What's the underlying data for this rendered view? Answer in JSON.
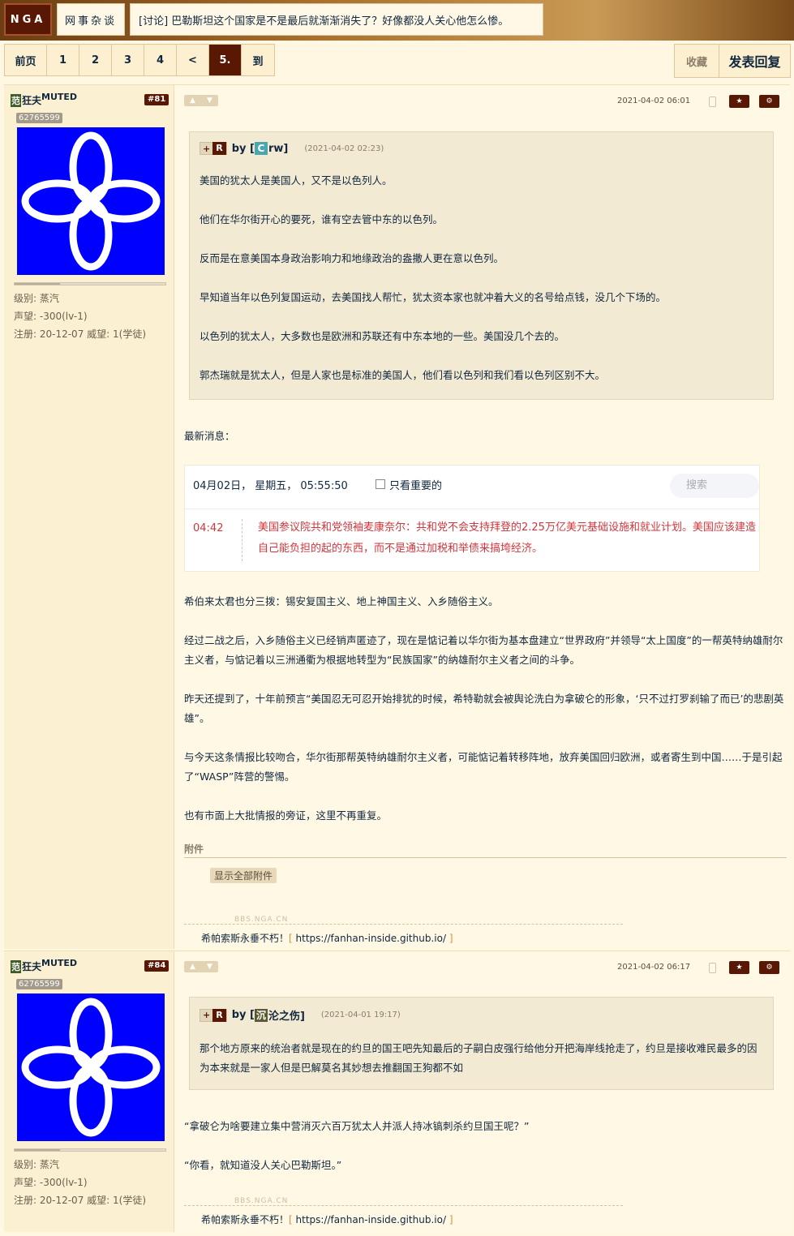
{
  "nav": {
    "logo": "NGA",
    "board": "网事杂谈",
    "thread_title": "[讨论] 巴勒斯坦这个国家是不是最后就渐渐消失了？好像都没人关心他怎么惨。"
  },
  "pager": {
    "first": "前页",
    "pages": [
      "1",
      "2",
      "3",
      "4"
    ],
    "prev": "<",
    "current": "5.",
    "goto": "到"
  },
  "actions": {
    "favorite": "收藏",
    "reply": "发表回复"
  },
  "posts": [
    {
      "user": {
        "prefix": "范",
        "name": "狂夫",
        "tag": "MUTED",
        "floor": "#81",
        "uid": "62765599",
        "level": "级别: 蒸汽",
        "fame": "声望: -300(lv-1)",
        "reg": "注册: 20-12-07",
        "prestige": "威望: 1(学徒)"
      },
      "time": "2021-04-02 06:01",
      "quote": {
        "by": "by [",
        "author": "rw]",
        "author_initial": "C",
        "qtime": "(2021-04-02 02:23)",
        "paras": [
          "美国的犹太人是美国人，又不是以色列人。",
          "他们在华尔街开心的要死，谁有空去管中东的以色列。",
          "反而是在意美国本身政治影响力和地缘政治的盎撒人更在意以色列。",
          "早知道当年以色列复国运动，去美国找人帮忙，犹太资本家也就冲着大义的名号给点钱，没几个下场的。",
          "以色列的犹太人，大多数也是欧洲和苏联还有中东本地的一些。美国没几个去的。",
          "郭杰瑞就是犹太人，但是人家也是标准的美国人，他们看以色列和我们看以色列区别不大。"
        ]
      },
      "latest": "最新消息：",
      "news": {
        "date": "04月02日，  星期五，  05:55:50",
        "only_important": "只看重要的",
        "search": "搜索",
        "time": "04:42",
        "msg": "美国参议院共和党领袖麦康奈尔：共和党不会支持拜登的2.25万亿美元基础设施和就业计划。美国应该建造自己能负担的起的东西，而不是通过加税和举债来搞垮经济。"
      },
      "paras": [
        "希伯来太君也分三拨：锡安复国主义、地上神国主义、入乡随俗主义。",
        "经过二战之后，入乡随俗主义已经销声匿迹了，现在是惦记着以华尔街为基本盘建立“世界政府”并领导“太上国度”的一帮英特纳雄耐尔主义者，与惦记着以三洲通衢为根据地转型为“民族国家”的纳雄耐尔主义者之间的斗争。",
        "昨天还提到了，十年前预言“美国忍无可忍开始排犹的时候，希特勒就会被舆论洗白为拿破仑的形象，‘只不过打罗刹输了而已’的悲剧英雄”。",
        "与今天这条情报比较吻合，华尔街那帮英特纳雄耐尔主义者，可能惦记着转移阵地，放弃美国回归欧洲，或者寄生到中国……于是引起了“WASP”阵营的警惕。",
        "也有市面上大批情报的旁证，这里不再重复。"
      ],
      "attach": "附件",
      "show_all": "显示全部附件",
      "sig": {
        "wm": "BBS.NGA.CN",
        "text": "希帕索斯永垂不朽！",
        "link": "https://fanhan-inside.github.io/"
      }
    },
    {
      "user": {
        "prefix": "范",
        "name": "狂夫",
        "tag": "MUTED",
        "floor": "#84",
        "uid": "62765599",
        "level": "级别: 蒸汽",
        "fame": "声望: -300(lv-1)",
        "reg": "注册: 20-12-07",
        "prestige": "威望: 1(学徒)"
      },
      "time": "2021-04-02 06:17",
      "quote": {
        "by": "by [",
        "author": "沦之伤]",
        "author_initial": "沉",
        "qtime": "(2021-04-01 19:17)",
        "paras": [
          "那个地方原来的统治者就是现在的约旦的国王吧先知最后的子嗣白皮强行给他分开把海岸线抢走了，约旦是接收难民最多的因为本来就是一家人但是巴解莫名其妙想去推翻国王狗都不如"
        ]
      },
      "paras": [
        "“拿破仑为啥要建立集中营消灭六百万犹太人并派人持冰镐刺杀约旦国王呢？”",
        "“你看，就知道没人关心巴勒斯坦。”"
      ],
      "sig": {
        "wm": "BBS.NGA.CN",
        "text": "希帕索斯永垂不朽！",
        "link": "https://fanhan-inside.github.io/"
      }
    }
  ]
}
